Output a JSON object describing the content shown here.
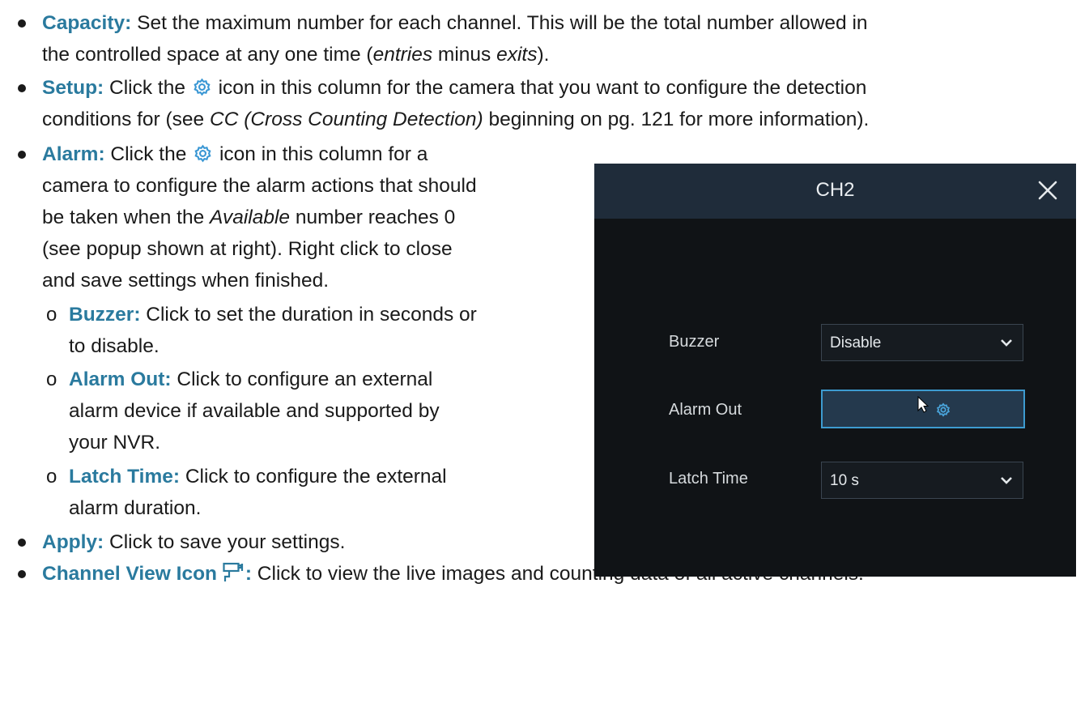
{
  "capacity": {
    "term": "Capacity:",
    "text1": " Set the maximum number for each channel. This will be the total number allowed in",
    "text2a": "the controlled space at any one time (",
    "italic1": "entries",
    "text2b": " minus ",
    "italic2": "exits",
    "text2c": ")."
  },
  "setup": {
    "term": "Setup:",
    "text1a": " Click the ",
    "text1b": " icon in this column for the camera that you want to configure the detection",
    "text2a": "conditions for (see ",
    "italic": "CC (Cross Counting Detection)",
    "text2b": " beginning on pg. 121 for more information)."
  },
  "alarm": {
    "term": "Alarm:",
    "text1a": " Click the ",
    "text1b": " icon in this column for a",
    "lines": [
      "camera to configure the alarm actions that should",
      "be taken when the "
    ],
    "italic": "Available",
    "line2b": " number reaches 0",
    "lines_after": [
      "(see popup shown at right). Right click to close",
      "and save settings when finished."
    ]
  },
  "sub_items": [
    {
      "term": "Buzzer:",
      "line1": " Click to set the duration in seconds or",
      "line2": "to disable."
    },
    {
      "term": "Alarm Out:",
      "line1": " Click to configure an external",
      "line2": "alarm device if available and supported by",
      "line3": "your NVR."
    },
    {
      "term": "Latch Time:",
      "line1": " Click to configure the external",
      "line2": "alarm duration."
    }
  ],
  "apply": {
    "term": "Apply:",
    "text": " Click to save your settings."
  },
  "channel_view": {
    "term": "Channel View Icon ",
    "colon": ":",
    "text": " Click to view the live images and counting data of all active channels."
  },
  "dialog": {
    "title": "CH2",
    "rows": [
      {
        "label": "Buzzer",
        "value": "Disable"
      },
      {
        "label": "Alarm Out",
        "value": ""
      },
      {
        "label": "Latch Time",
        "value": "10 s"
      }
    ]
  },
  "colors": {
    "term": "#2a7a9e",
    "dialog_bg": "#101316",
    "dialog_header": "#1f2c3a",
    "accent": "#3d9bd0"
  },
  "icons": [
    "gear-icon",
    "close-icon",
    "chevron-down-icon",
    "cursor-icon",
    "channel-view-icon"
  ]
}
